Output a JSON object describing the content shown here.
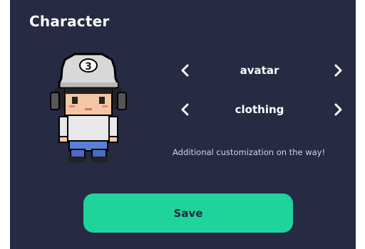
{
  "title": "Character",
  "options": [
    {
      "label": "avatar"
    },
    {
      "label": "clothing"
    }
  ],
  "note": "Additional customization on the way!",
  "save_label": "Save",
  "icons": {
    "prev": "chevron-left-icon",
    "next": "chevron-right-icon",
    "cap_badge": "3"
  },
  "colors": {
    "panel_bg": "#262a42",
    "accent": "#1fd49b",
    "text": "#ffffff",
    "note_text": "#cfd2f0"
  }
}
